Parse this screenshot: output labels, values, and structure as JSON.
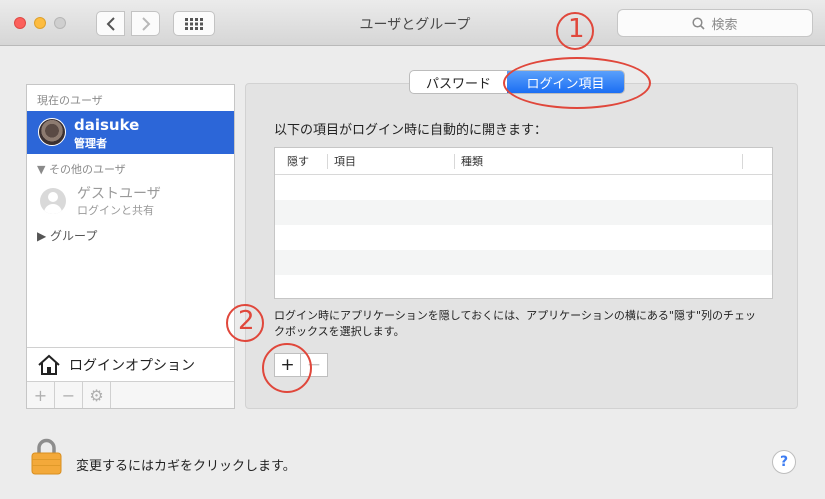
{
  "window": {
    "title": "ユーザとグループ"
  },
  "search": {
    "placeholder": "検索"
  },
  "sidebar": {
    "current_users_label": "現在のユーザ",
    "selected_user": {
      "name": "daisuke",
      "role": "管理者"
    },
    "other_users_label": "▼ その他のユーザ",
    "guest_user": {
      "name": "ゲストユーザ",
      "sub": "ログインと共有"
    },
    "groups_label": "▶ グループ",
    "login_options_label": "ログインオプション",
    "footer": {
      "add": "+",
      "remove": "−",
      "gear": "⚙"
    }
  },
  "tabs": {
    "password": "パスワード",
    "login_items": "ログイン項目"
  },
  "main": {
    "description": "以下の項目がログイン時に自動的に開きます：",
    "columns": {
      "hide": "隠す",
      "item": "項目",
      "kind": "種類"
    },
    "rows": 5,
    "note": "ログイン時にアプリケーションを隠しておくには、アプリケーションの横にある\"隠す\"列のチェックボックスを選択します。",
    "add_label": "+",
    "remove_label": "−"
  },
  "annotations": {
    "one": "1",
    "two": "2"
  },
  "bottom": {
    "lock_text": "変更するにはカギをクリックします。",
    "help": "?"
  },
  "colors": {
    "accent": "#2c66d8",
    "annotation": "#e0473b",
    "tab_active": "#1b6ef3"
  }
}
